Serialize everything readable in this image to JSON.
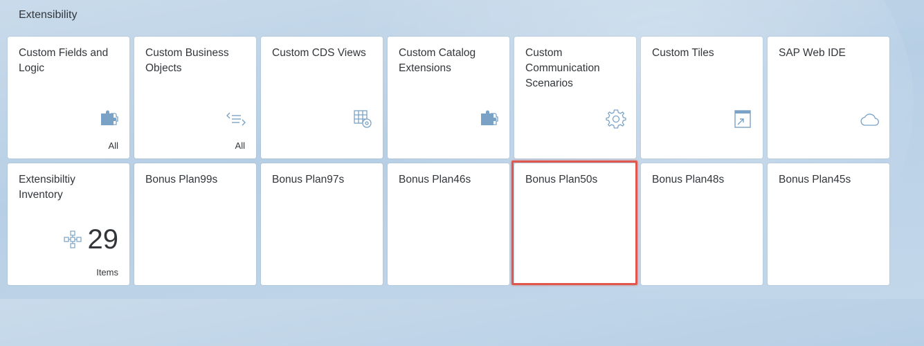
{
  "group": {
    "title": "Extensibility"
  },
  "row1": [
    {
      "title": "Custom Fields and Logic",
      "icon": "puzzle-icon",
      "footer": "All"
    },
    {
      "title": "Custom Business Objects",
      "icon": "list-code-icon",
      "footer": "All"
    },
    {
      "title": "Custom CDS Views",
      "icon": "table-gear-icon"
    },
    {
      "title": "Custom Catalog Extensions",
      "icon": "puzzle-icon"
    },
    {
      "title": "Custom Communication Scenarios",
      "icon": "gear-icon"
    },
    {
      "title": "Custom Tiles",
      "icon": "tile-launch-icon"
    },
    {
      "title": "SAP Web IDE",
      "icon": "cloud-icon"
    }
  ],
  "row2": [
    {
      "title": "Extensibiltiy Inventory",
      "icon": "network-icon",
      "kpi": "29",
      "footer": "Items"
    },
    {
      "title": "Bonus Plan99s"
    },
    {
      "title": "Bonus Plan97s"
    },
    {
      "title": "Bonus Plan46s"
    },
    {
      "title": "Bonus Plan50s"
    },
    {
      "title": "Bonus Plan48s"
    },
    {
      "title": "Bonus Plan45s"
    }
  ],
  "colors": {
    "icon": "#7aa2c6",
    "highlight": "#e0574d",
    "text": "#32363a"
  }
}
